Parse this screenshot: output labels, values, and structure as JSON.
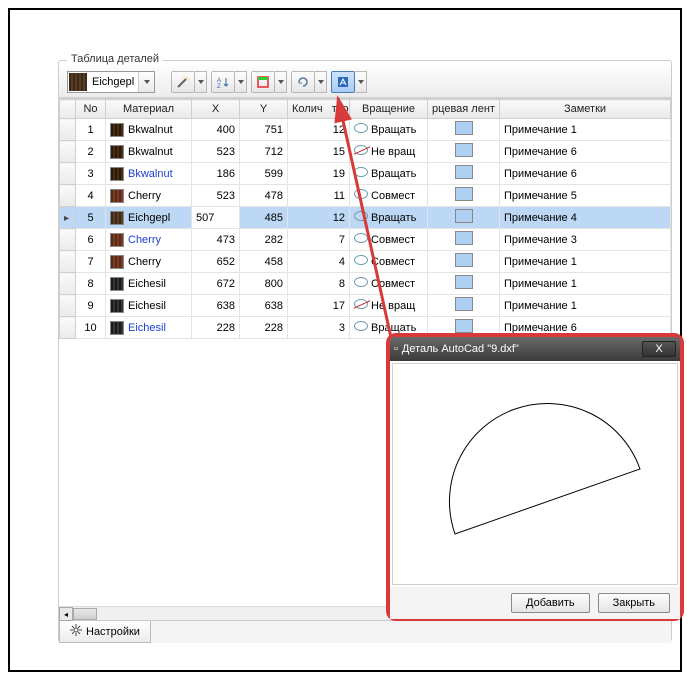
{
  "panel_title": "Таблица деталей",
  "material_selector": {
    "label": "Eichgepl"
  },
  "columns": {
    "no": "No",
    "material": "Материал",
    "x": "X",
    "y": "Y",
    "count": "Колич   тво",
    "rotation": "Вращение",
    "edge": "рцевая лент",
    "notes": "Заметки"
  },
  "rows": [
    {
      "no": "1",
      "material": "Bkwalnut",
      "sw": "bkwalnut",
      "link": false,
      "x": "400",
      "y": "751",
      "count": "12",
      "rot": "Вращать",
      "rot_ok": true,
      "note": "Примечание 1"
    },
    {
      "no": "2",
      "material": "Bkwalnut",
      "sw": "bkwalnut",
      "link": false,
      "x": "523",
      "y": "712",
      "count": "15",
      "rot": "Не вращ",
      "rot_ok": false,
      "note": "Примечание 6"
    },
    {
      "no": "3",
      "material": "Bkwalnut",
      "sw": "bkwalnut",
      "link": true,
      "x": "186",
      "y": "599",
      "count": "19",
      "rot": "Вращать",
      "rot_ok": true,
      "note": "Примечание 6"
    },
    {
      "no": "4",
      "material": "Cherry",
      "sw": "cherry",
      "link": false,
      "x": "523",
      "y": "478",
      "count": "11",
      "rot": "Совмест",
      "rot_ok": true,
      "note": "Примечание 5"
    },
    {
      "no": "5",
      "material": "Eichgepl",
      "sw": "eichgepl",
      "link": false,
      "x": "507",
      "y": "485",
      "count": "12",
      "rot": "Вращать",
      "rot_ok": true,
      "note": "Примечание 4",
      "selected": true
    },
    {
      "no": "6",
      "material": "Cherry",
      "sw": "cherry",
      "link": true,
      "x": "473",
      "y": "282",
      "count": "7",
      "rot": "Совмест",
      "rot_ok": true,
      "note": "Примечание 3"
    },
    {
      "no": "7",
      "material": "Cherry",
      "sw": "cherry",
      "link": false,
      "x": "652",
      "y": "458",
      "count": "4",
      "rot": "Совмест",
      "rot_ok": true,
      "note": "Примечание 1"
    },
    {
      "no": "8",
      "material": "Eichesil",
      "sw": "eichesil",
      "link": false,
      "x": "672",
      "y": "800",
      "count": "8",
      "rot": "Совмест",
      "rot_ok": true,
      "note": "Примечание 1"
    },
    {
      "no": "9",
      "material": "Eichesil",
      "sw": "eichesil",
      "link": false,
      "x": "638",
      "y": "638",
      "count": "17",
      "rot": "Не вращ",
      "rot_ok": false,
      "note": "Примечание 1"
    },
    {
      "no": "10",
      "material": "Eichesil",
      "sw": "eichesil",
      "link": true,
      "x": "228",
      "y": "228",
      "count": "3",
      "rot": "Вращать",
      "rot_ok": true,
      "note": "Примечание 6"
    }
  ],
  "tab_settings": "Настройки",
  "dialog": {
    "title": "Деталь AutoCad \"9.dxf\"",
    "add": "Добавить",
    "close": "Закрыть",
    "x": "X"
  }
}
